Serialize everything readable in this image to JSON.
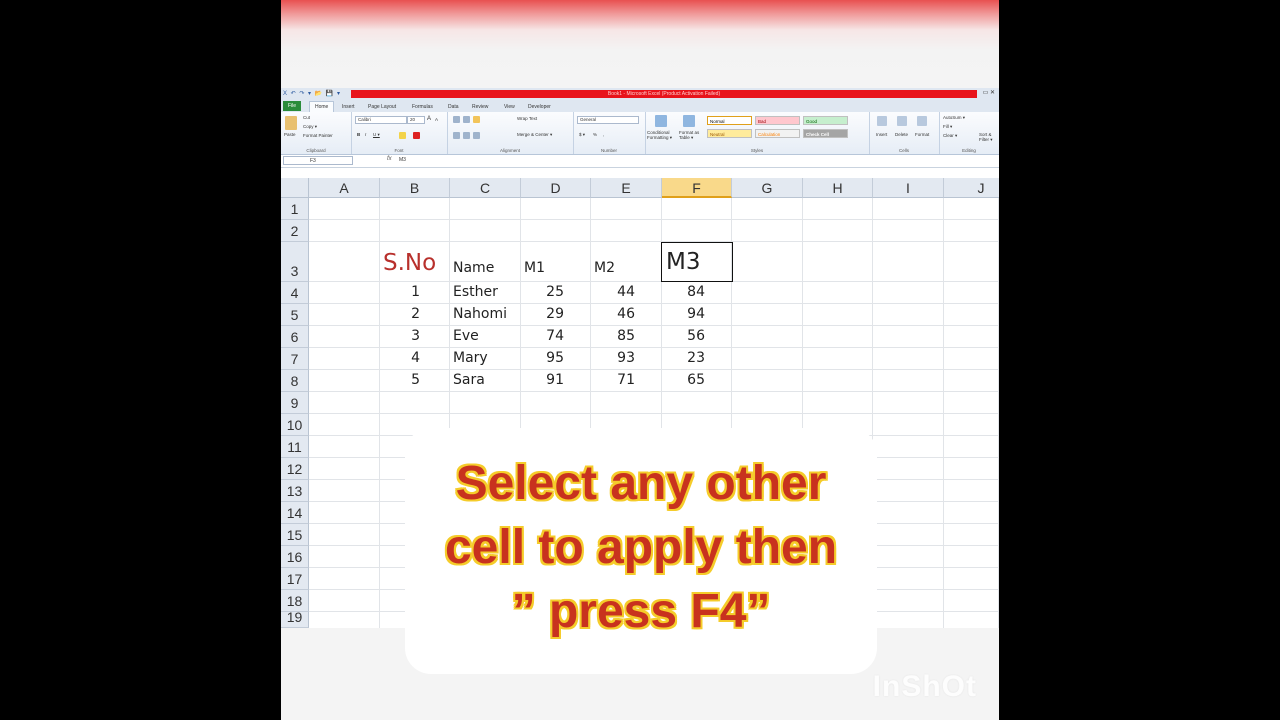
{
  "window": {
    "title": "Book1 - Microsoft Excel (Product Activation Failed)",
    "qat": "X ↶ ↷ ▾ 📂 💾 ▾",
    "controls": "▭ ✕"
  },
  "tabs": [
    "File",
    "Home",
    "Insert",
    "Page Layout",
    "Formulas",
    "Data",
    "Review",
    "View",
    "Developer"
  ],
  "ribbon": {
    "clipboard": {
      "label": "Clipboard",
      "paste": "Paste",
      "cut": "Cut",
      "copy": "Copy ▾",
      "format_painter": "Format Painter"
    },
    "font": {
      "label": "Font",
      "name": "Calibri",
      "size": "20",
      "grow": "A",
      "shrink": "A",
      "bold": "B",
      "italic": "I",
      "underline": "U ▾"
    },
    "alignment": {
      "label": "Alignment",
      "wrap": "Wrap Text",
      "merge": "Merge & Center ▾"
    },
    "number": {
      "label": "Number",
      "format": "General",
      "currency": "$ ▾",
      "percent": "%",
      "comma": ","
    },
    "styles": {
      "label": "Styles",
      "conditional": "Conditional Formatting ▾",
      "format_table": "Format as Table ▾",
      "normal": "Normal",
      "bad": "Bad",
      "good": "Good",
      "neutral": "Neutral",
      "calculation": "Calculation",
      "check_cell": "Check Cell"
    },
    "cells": {
      "label": "Cells",
      "insert": "Insert",
      "delete": "Delete",
      "format": "Format"
    },
    "editing": {
      "label": "Editing",
      "autosum": "AutoSum ▾",
      "fill": "Fill ▾",
      "clear": "Clear ▾",
      "sort": "Sort & Filter ▾"
    }
  },
  "formula_bar": {
    "name_box": "F3",
    "fx": "fx",
    "content": "M3"
  },
  "columns": [
    "A",
    "B",
    "C",
    "D",
    "E",
    "F",
    "G",
    "H",
    "I",
    "J"
  ],
  "selected_column": "F",
  "rows": [
    "1",
    "2",
    "3",
    "4",
    "5",
    "6",
    "7",
    "8",
    "9",
    "10",
    "11",
    "12",
    "13",
    "14",
    "15",
    "16",
    "17",
    "18",
    "19"
  ],
  "sheet": {
    "headers": {
      "sno": "S.No",
      "name": "Name",
      "m1": "M1",
      "m2": "M2",
      "m3": "M3"
    },
    "records": [
      {
        "sno": "1",
        "name": "Esther",
        "m1": "25",
        "m2": "44",
        "m3": "84"
      },
      {
        "sno": "2",
        "name": "Nahomi",
        "m1": "29",
        "m2": "46",
        "m3": "94"
      },
      {
        "sno": "3",
        "name": "Eve",
        "m1": "74",
        "m2": "85",
        "m3": "56"
      },
      {
        "sno": "4",
        "name": "Mary",
        "m1": "95",
        "m2": "93",
        "m3": "23"
      },
      {
        "sno": "5",
        "name": "Sara",
        "m1": "91",
        "m2": "71",
        "m3": "65"
      }
    ]
  },
  "caption": {
    "line1": "Select any other",
    "line2": "cell to apply then",
    "line3": "” press F4”"
  },
  "watermark": "InShOt",
  "colors": {
    "header_red": "#b8302c",
    "caption_text": "#c8321e",
    "caption_outline": "#f5cc2a",
    "file_tab": "#2a8c3a"
  }
}
